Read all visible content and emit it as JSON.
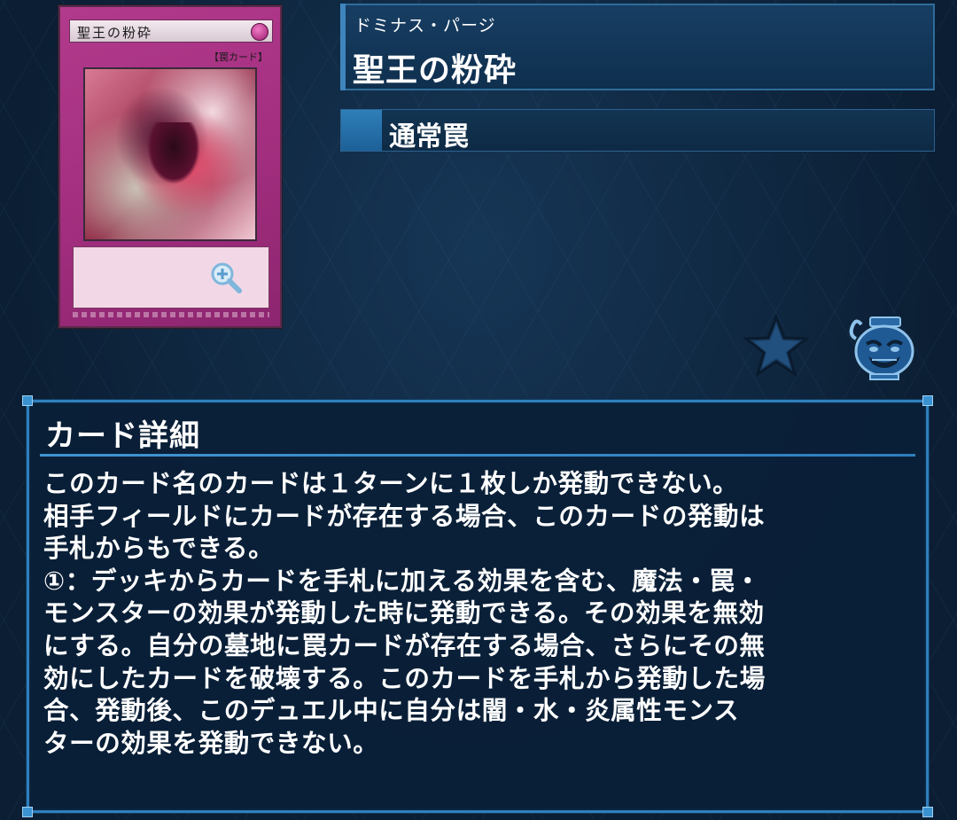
{
  "card": {
    "image_name": "聖王の粉砕",
    "image_type_label": "【罠カード】",
    "ruby": "ドミナス・パージ",
    "name": "聖王の粉砕",
    "type": "通常罠"
  },
  "icons": {
    "zoom": "zoom-in-icon",
    "favorite": "star-icon",
    "extra": "pot-of-greed-icon"
  },
  "detail": {
    "heading": "カード詳細",
    "lines": [
      "このカード名のカードは１ターンに１枚しか発動できない。",
      "相手フィールドにカードが存在する場合、このカードの発動は",
      "手札からもできる。",
      "①：デッキからカードを手札に加える効果を含む、魔法・罠・",
      "モンスターの効果が発動した時に発動できる。その効果を無効",
      "にする。自分の墓地に罠カードが存在する場合、さらにその無",
      "効にしたカードを破壊する。このカードを手札から発動した場",
      "合、発動後、このデュエル中に自分は闇・水・炎属性モンス",
      "ターの効果を発動できない。"
    ]
  },
  "colors": {
    "background": "#0c2036",
    "panel_border": "#2f7fbd",
    "trap_card": "#a42f80"
  }
}
